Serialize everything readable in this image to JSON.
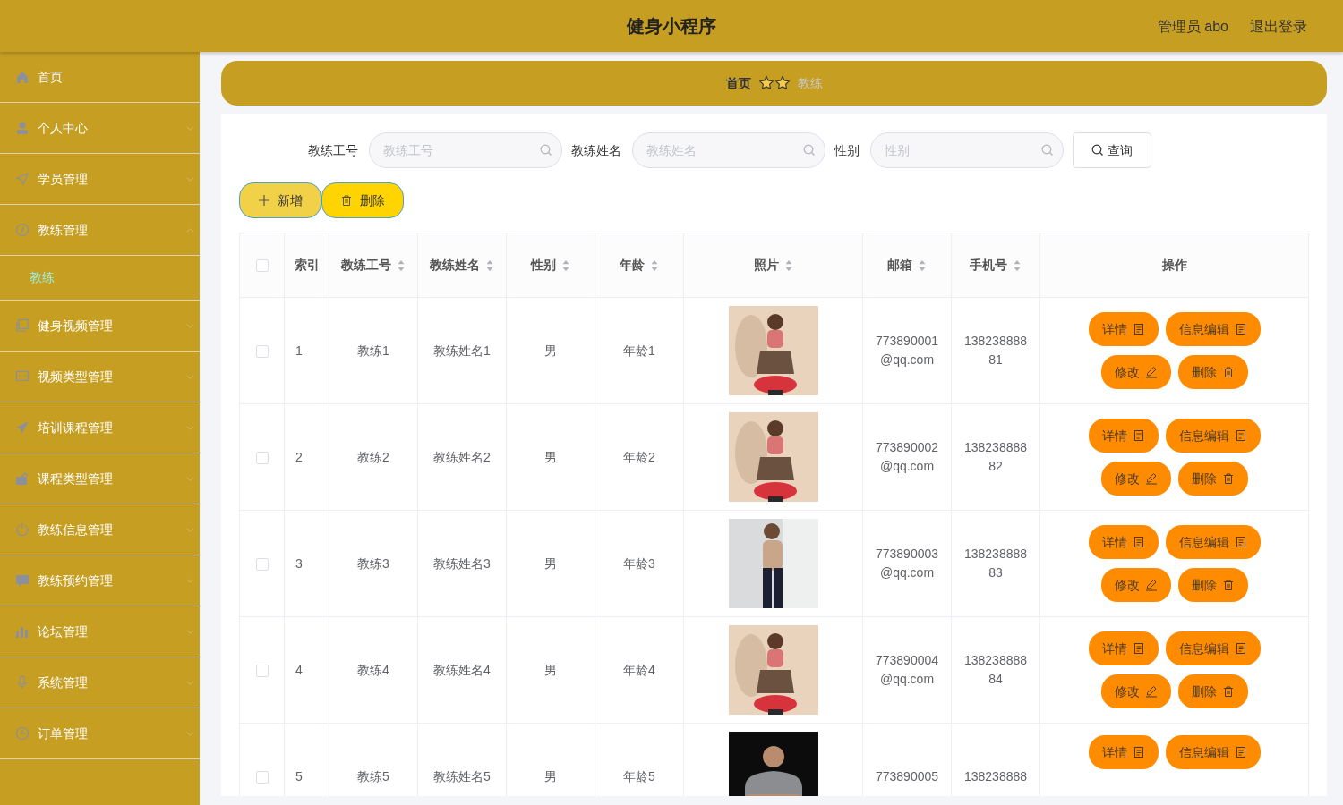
{
  "header": {
    "title": "健身小程序",
    "user": "管理员 abo",
    "logout": "退出登录"
  },
  "sidebar": {
    "items": [
      {
        "label": "首页",
        "selected": false
      },
      {
        "label": "个人中心",
        "selected": false,
        "expanded": false
      },
      {
        "label": "学员管理",
        "selected": false,
        "expanded": false
      },
      {
        "label": "教练管理",
        "selected": false,
        "expanded": true,
        "children": [
          {
            "label": "教练",
            "selected": true
          }
        ]
      },
      {
        "label": "健身视频管理",
        "selected": false,
        "expanded": false
      },
      {
        "label": "视频类型管理",
        "selected": false,
        "expanded": false
      },
      {
        "label": "培训课程管理",
        "selected": false,
        "expanded": false
      },
      {
        "label": "课程类型管理",
        "selected": false,
        "expanded": false
      },
      {
        "label": "教练信息管理",
        "selected": false,
        "expanded": false
      },
      {
        "label": "教练预约管理",
        "selected": false,
        "expanded": false
      },
      {
        "label": "论坛管理",
        "selected": false,
        "expanded": false
      },
      {
        "label": "系统管理",
        "selected": false,
        "expanded": false
      },
      {
        "label": "订单管理",
        "selected": false,
        "expanded": false
      }
    ]
  },
  "breadcrumb": {
    "home": "首页",
    "current": "教练"
  },
  "search": {
    "fields": [
      {
        "label": "教练工号",
        "placeholder": "教练工号"
      },
      {
        "label": "教练姓名",
        "placeholder": "教练姓名"
      },
      {
        "label": "性别",
        "placeholder": "性别"
      }
    ],
    "button": "查询"
  },
  "actions": [
    "新增",
    "删除"
  ],
  "table": {
    "all_selected": false,
    "columns": [
      {
        "label": "索引",
        "sortable": false
      },
      {
        "label": "教练工号",
        "sortable": true
      },
      {
        "label": "教练姓名",
        "sortable": true
      },
      {
        "label": "性别",
        "sortable": true
      },
      {
        "label": "年龄",
        "sortable": true
      },
      {
        "label": "照片",
        "sortable": true
      },
      {
        "label": "邮箱",
        "sortable": true
      },
      {
        "label": "手机号",
        "sortable": true
      },
      {
        "label": "操作",
        "sortable": false
      }
    ],
    "rows": [
      {
        "selected": false,
        "index": "1",
        "id": "教练1",
        "name": "教练姓名1",
        "gender": "男",
        "age": "年龄1",
        "email": "773890001@qq.com",
        "phone": "13823888881",
        "buttons": [
          "详情",
          "信息编辑",
          "修改",
          "删除"
        ]
      },
      {
        "selected": false,
        "index": "2",
        "id": "教练2",
        "name": "教练姓名2",
        "gender": "男",
        "age": "年龄2",
        "email": "773890002@qq.com",
        "phone": "13823888882",
        "buttons": [
          "详情",
          "信息编辑",
          "修改",
          "删除"
        ]
      },
      {
        "selected": false,
        "index": "3",
        "id": "教练3",
        "name": "教练姓名3",
        "gender": "男",
        "age": "年龄3",
        "email": "773890003@qq.com",
        "phone": "13823888883",
        "buttons": [
          "详情",
          "信息编辑",
          "修改",
          "删除"
        ]
      },
      {
        "selected": false,
        "index": "4",
        "id": "教练4",
        "name": "教练姓名4",
        "gender": "男",
        "age": "年龄4",
        "email": "773890004@qq.com",
        "phone": "13823888884",
        "buttons": [
          "详情",
          "信息编辑",
          "修改",
          "删除"
        ]
      },
      {
        "selected": false,
        "index": "5",
        "id": "教练5",
        "name": "教练姓名5",
        "gender": "男",
        "age": "年龄5",
        "email": "773890005",
        "phone": "138238888",
        "buttons": [
          "详情",
          "信息编辑"
        ]
      }
    ]
  }
}
